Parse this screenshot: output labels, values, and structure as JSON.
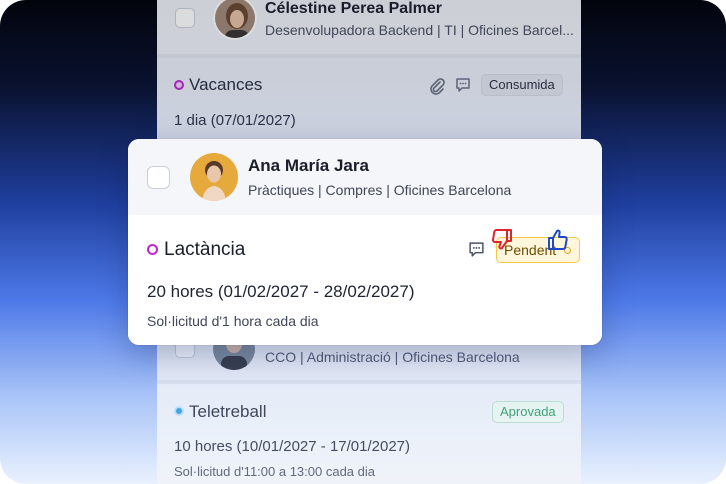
{
  "colors": {
    "accent_purple": "#c026d3",
    "accent_blue": "#2ea0e6",
    "pending_bg": "#fff6dc",
    "pending_border": "#f3c948",
    "approved_text": "#2f9a63",
    "reject_red": "#e0242b",
    "approve_blue": "#1f49c9"
  },
  "list": {
    "top_employee": {
      "name": "Célestine Perea Palmer",
      "meta": "Desenvolupadora Backend | TI | Oficines Barcel..."
    },
    "vacances": {
      "title": "Vacances",
      "badge": "Consumida",
      "hours": "1 dia (07/01/2027)",
      "icons": [
        "paperclip-icon",
        "comment-icon"
      ]
    },
    "hidden_employee": {
      "meta": "CCO | Administració | Oficines Barcelona"
    },
    "teletreball": {
      "title": "Teletreball",
      "badge": "Aprovada",
      "hours": "10 hores (10/01/2027 - 17/01/2027)",
      "description": "Sol·licitud d'11:00 a 13:00 cada dia"
    }
  },
  "card": {
    "employee": {
      "name": "Ana María Jara",
      "meta": "Pràctiques | Compres | Oficines Barcelona"
    },
    "request": {
      "title": "Lactància",
      "badge": "Pendent",
      "hours": "20 hores (01/02/2027 - 28/02/2027)",
      "description": "Sol·licitud d'1 hora cada dia",
      "icons": [
        "comment-icon",
        "thumbs-down-icon",
        "thumbs-up-icon"
      ]
    }
  }
}
